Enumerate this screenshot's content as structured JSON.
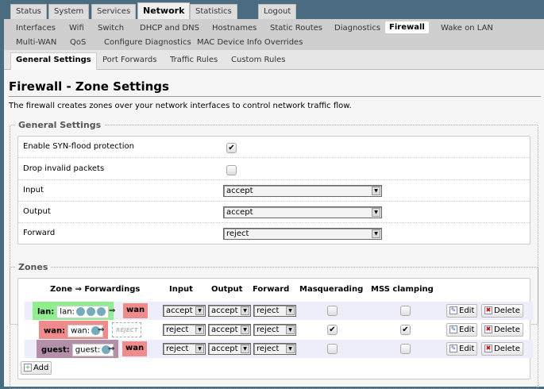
{
  "top_tabs": [
    "Status",
    "System",
    "Services",
    "Network",
    "Statistics",
    "Logout"
  ],
  "sub_nav": [
    "Interfaces",
    "Wifi",
    "Switch",
    "DHCP and DNS",
    "Hostnames",
    "Static Routes",
    "Diagnostics",
    "Firewall",
    "Wake on LAN",
    "Multi-WAN",
    "QoS",
    "Configure Diagnostics",
    "MAC Device Info Overrides"
  ],
  "content_tabs": [
    "General Settings",
    "Port Forwards",
    "Traffic Rules",
    "Custom Rules"
  ],
  "title": "Firewall - Zone Settings",
  "description": "The firewall creates zones over your network interfaces to control network traffic flow.",
  "general": {
    "legend": "General Settings",
    "syn_label": "Enable SYN-flood protection",
    "syn_checked": true,
    "drop_label": "Drop invalid packets",
    "drop_checked": false,
    "input_label": "Input",
    "input_value": "accept",
    "output_label": "Output",
    "output_value": "accept",
    "forward_label": "Forward",
    "forward_value": "reject"
  },
  "zones": {
    "legend": "Zones",
    "headers": [
      "Zone ⇒ Forwardings",
      "Input",
      "Output",
      "Forward",
      "Masquerading",
      "MSS clamping"
    ],
    "arrow": "⇒",
    "edit": "Edit",
    "delete": "Delete",
    "add": "Add",
    "rows": [
      {
        "name": "lan:",
        "iface": "lan:",
        "color": "#90ee90",
        "fwd": "wan",
        "input": "accept",
        "output": "accept",
        "forward": "reject",
        "masq": false,
        "mss": false
      },
      {
        "name": "wan:",
        "iface": "wan:",
        "color": "#f08b8b",
        "fwd": "REJECT",
        "input": "reject",
        "output": "accept",
        "forward": "reject",
        "masq": true,
        "mss": true
      },
      {
        "name": "guest:",
        "iface": "guest:",
        "color": "#b490a8",
        "fwd": "wan",
        "input": "reject",
        "output": "accept",
        "forward": "reject",
        "masq": false,
        "mss": false
      }
    ]
  }
}
